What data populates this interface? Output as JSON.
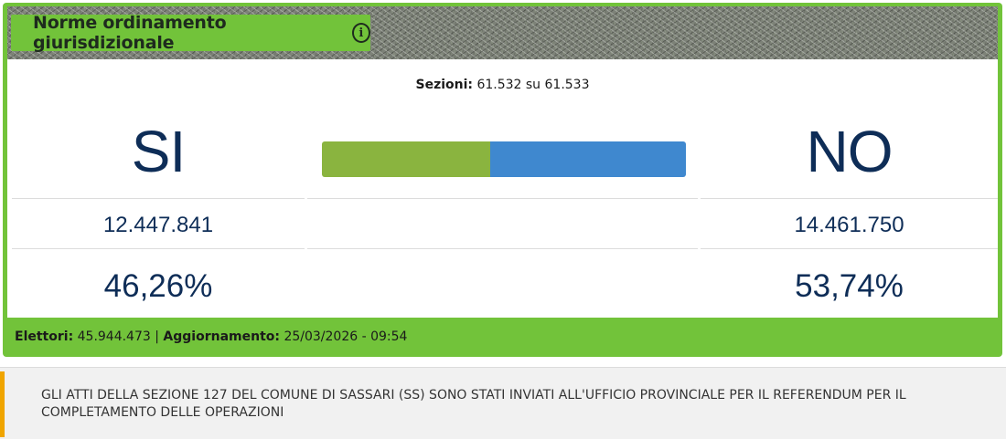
{
  "title": "Norme ordinamento giurisdizionale",
  "info_icon": "info-icon",
  "sezioni": {
    "label": "Sezioni:",
    "value": "61.532 su 61.533"
  },
  "si": {
    "label": "SI",
    "votes": "12.447.841",
    "percent": "46,26%"
  },
  "no": {
    "label": "NO",
    "votes": "14.461.750",
    "percent": "53,74%"
  },
  "bar": {
    "si_fraction": 0.4626,
    "si_color": "#8ab43f",
    "no_color": "#3f88cf"
  },
  "footer": {
    "elettori_label": "Elettori:",
    "elettori_value": "45.944.473",
    "separator": "|",
    "aggiornamento_label": "Aggiornamento:",
    "aggiornamento_value": "25/03/2026 - 09:54"
  },
  "notice": "GLI ATTI DELLA SEZIONE 127 DEL COMUNE DI SASSARI (SS) SONO STATI INVIATI ALL'UFFICIO PROVINCIALE PER IL REFERENDUM PER IL COMPLETAMENTO DELLE OPERAZIONI",
  "colors": {
    "accent_green": "#72c33a",
    "text_navy": "#0e2d57",
    "notice_accent": "#f0a500"
  }
}
